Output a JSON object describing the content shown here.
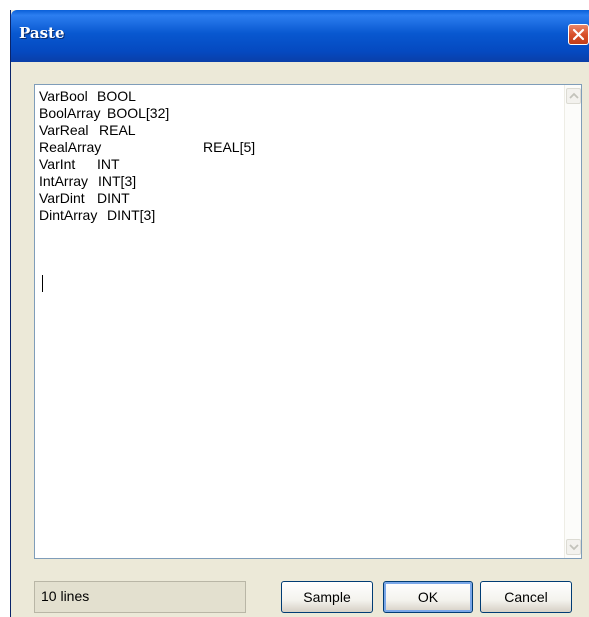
{
  "dialog": {
    "title": "Paste"
  },
  "editor": {
    "lines": [
      {
        "name": "VarBool",
        "type": "BOOL"
      },
      {
        "name": "BoolArray",
        "type": "BOOL[32]"
      },
      {
        "name": "VarReal",
        "type": "REAL"
      },
      {
        "name": "RealArray",
        "type": "REAL[5]"
      },
      {
        "name": "VarInt",
        "type": "INT"
      },
      {
        "name": "IntArray",
        "type": "INT[3]"
      },
      {
        "name": "VarDint",
        "type": "DINT"
      },
      {
        "name": "DintArray",
        "type": "DINT[3]"
      }
    ]
  },
  "status": {
    "line_count": "10 lines"
  },
  "buttons": {
    "sample": "Sample",
    "ok": "OK",
    "cancel": "Cancel"
  },
  "icons": {
    "close": "close-icon",
    "scroll_up": "chevron-up-icon",
    "scroll_down": "chevron-down-icon"
  }
}
